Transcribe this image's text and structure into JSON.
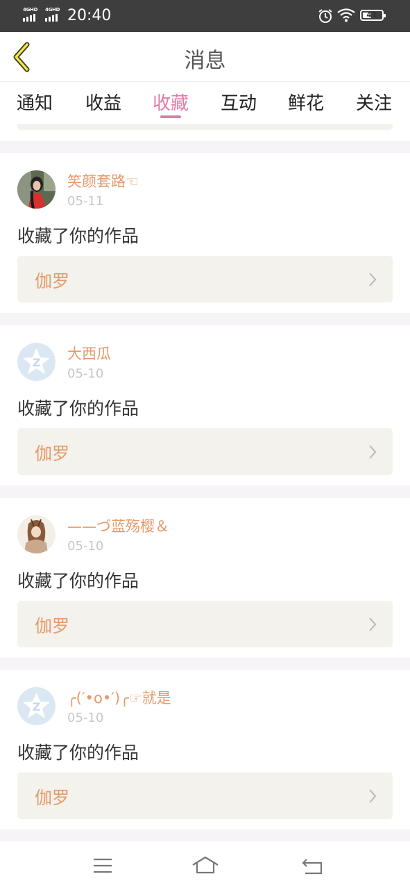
{
  "status_bar": {
    "signal1_label": "4GHD",
    "signal2_label": "4GHD",
    "time": "20:40",
    "battery_percent": "41",
    "icons": [
      "alarm-icon",
      "wifi-icon",
      "battery-icon"
    ]
  },
  "header": {
    "title": "消息",
    "back_icon": "chevron-left-icon"
  },
  "tabs": [
    {
      "label": "通知"
    },
    {
      "label": "收益"
    },
    {
      "label": "收藏"
    },
    {
      "label": "互动"
    },
    {
      "label": "鲜花"
    },
    {
      "label": "关注"
    }
  ],
  "active_tab": "收藏",
  "colors": {
    "accent": "#e07aa6",
    "username": "#e59a6b",
    "work_bg": "#f4f2ec",
    "status_bar_bg": "#3e3e3e"
  },
  "messages": [
    {
      "username": "笑颜套路☜",
      "time": "05-11",
      "action": "收藏了你的作品",
      "work": "伽罗",
      "avatar": "photo-avatar"
    },
    {
      "username": "大西瓜",
      "time": "05-10",
      "action": "收藏了你的作品",
      "work": "伽罗",
      "avatar": "default-avatar"
    },
    {
      "username": "——づ蓝殇樱＆",
      "time": "05-10",
      "action": "收藏了你的作品",
      "work": "伽罗",
      "avatar": "illustration-avatar"
    },
    {
      "username": "╭(′•ο•′)╭☞就是",
      "time": "05-10",
      "action": "收藏了你的作品",
      "work": "伽罗",
      "avatar": "default-avatar"
    }
  ],
  "bottom_nav": {
    "icons": [
      "menu-icon",
      "home-icon",
      "back-icon"
    ]
  }
}
